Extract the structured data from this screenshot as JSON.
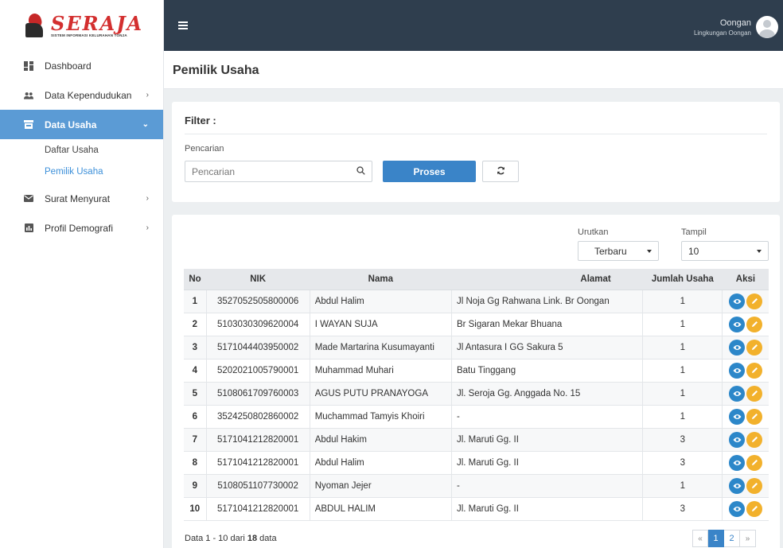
{
  "brand": {
    "logo_word": "SERAJA",
    "logo_sub": "SISTEM INFORMASI KELURAHAN TONJA"
  },
  "sidebar": {
    "items": [
      {
        "label": "Dashboard",
        "icon": "dashboard-icon"
      },
      {
        "label": "Data Kependudukan",
        "icon": "people-icon"
      },
      {
        "label": "Data Usaha",
        "icon": "store-icon"
      },
      {
        "label": "Surat Menyurat",
        "icon": "mail-icon"
      },
      {
        "label": "Profil Demografi",
        "icon": "chart-icon"
      }
    ],
    "sub_items": [
      {
        "label": "Daftar Usaha"
      },
      {
        "label": "Pemilik Usaha"
      }
    ]
  },
  "topbar": {
    "user_name": "Oongan",
    "user_role": "Lingkungan Oongan"
  },
  "page": {
    "title": "Pemilik Usaha"
  },
  "filter": {
    "title": "Filter :",
    "search_label": "Pencarian",
    "search_placeholder": "Pencarian",
    "search_value": "",
    "proses_label": "Proses"
  },
  "controls": {
    "sort_label": "Urutkan",
    "sort_value": "Terbaru",
    "show_label": "Tampil",
    "show_value": "10"
  },
  "table": {
    "headers": [
      "No",
      "NIK",
      "Nama",
      "Alamat",
      "Jumlah Usaha",
      "Aksi"
    ],
    "rows": [
      {
        "no": "1",
        "nik": "3527052505800006",
        "nama": "Abdul Halim",
        "alamat": "Jl Noja Gg Rahwana Link. Br Oongan",
        "jumlah": "1"
      },
      {
        "no": "2",
        "nik": "5103030309620004",
        "nama": "I WAYAN SUJA",
        "alamat": "Br Sigaran Mekar Bhuana",
        "jumlah": "1"
      },
      {
        "no": "3",
        "nik": "5171044403950002",
        "nama": "Made Martarina Kusumayanti",
        "alamat": "Jl Antasura I GG Sakura 5",
        "jumlah": "1"
      },
      {
        "no": "4",
        "nik": "5202021005790001",
        "nama": "Muhammad Muhari",
        "alamat": "Batu Tinggang",
        "jumlah": "1"
      },
      {
        "no": "5",
        "nik": "5108061709760003",
        "nama": "AGUS PUTU PRANAYOGA",
        "alamat": "Jl. Seroja Gg. Anggada No. 15",
        "jumlah": "1"
      },
      {
        "no": "6",
        "nik": "3524250802860002",
        "nama": "Muchammad Tamyis Khoiri",
        "alamat": "-",
        "jumlah": "1"
      },
      {
        "no": "7",
        "nik": "5171041212820001",
        "nama": "Abdul Hakim",
        "alamat": "Jl. Maruti Gg. II",
        "jumlah": "3"
      },
      {
        "no": "8",
        "nik": "5171041212820001",
        "nama": "Abdul Halim",
        "alamat": "Jl. Maruti Gg. II",
        "jumlah": "3"
      },
      {
        "no": "9",
        "nik": "5108051107730002",
        "nama": "Nyoman Jejer",
        "alamat": "-",
        "jumlah": "1"
      },
      {
        "no": "10",
        "nik": "5171041212820001",
        "nama": "ABDUL HALIM",
        "alamat": "Jl. Maruti Gg. II",
        "jumlah": "3"
      }
    ]
  },
  "footer": {
    "info_prefix": "Data 1 - 10 dari ",
    "info_total": "18",
    "info_suffix": " data",
    "pages": [
      "«",
      "1",
      "2",
      "»"
    ]
  },
  "colors": {
    "topbar": "#2f3e4e",
    "active_nav": "#5b9bd5",
    "primary": "#3a84c8",
    "view_btn": "#2c87c9",
    "edit_btn": "#f2b12c",
    "brand_red": "#d32f2f"
  }
}
